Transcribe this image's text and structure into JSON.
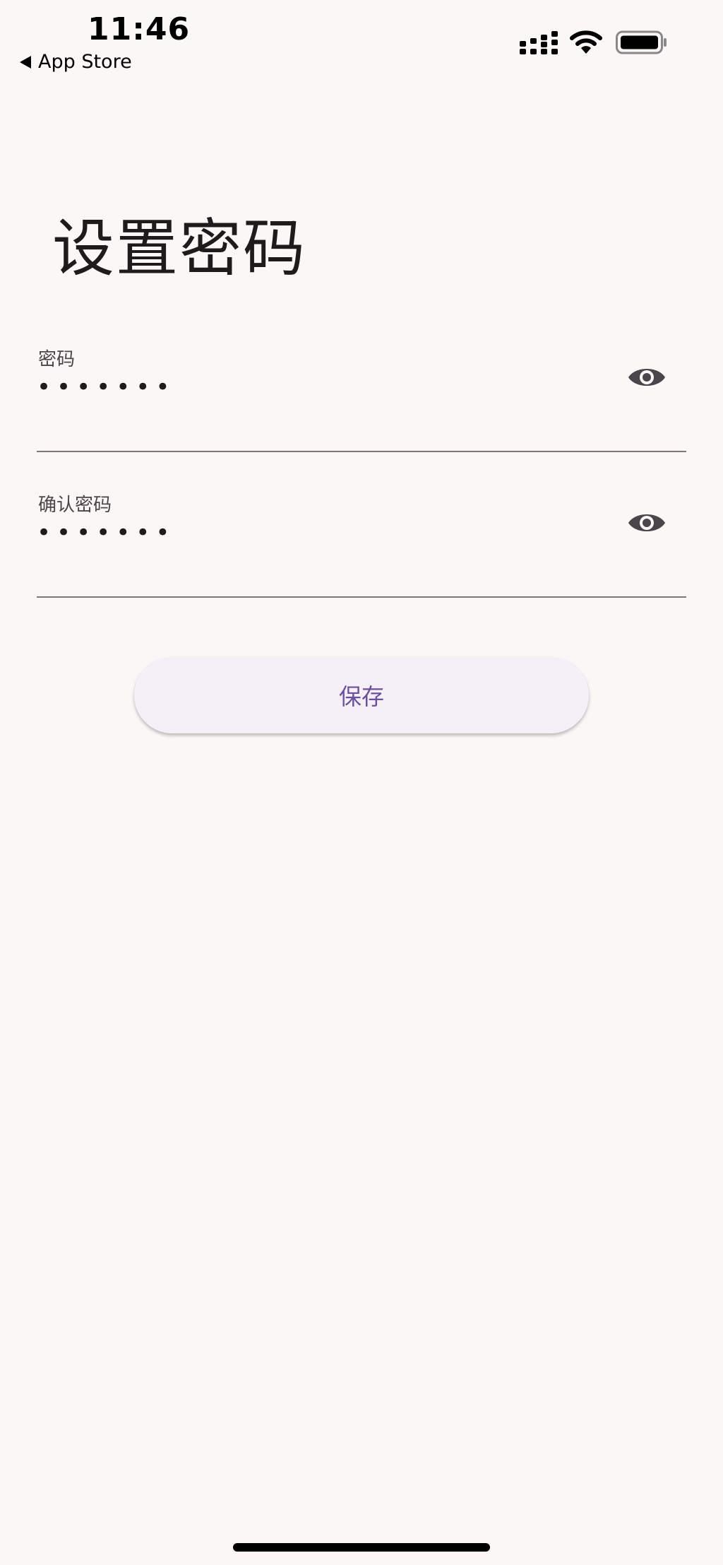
{
  "status_bar": {
    "time": "11:46",
    "back_label": "App Store",
    "icons": [
      "signal-icon",
      "wifi-icon",
      "battery-icon"
    ]
  },
  "page": {
    "title": "设置密码"
  },
  "form": {
    "password": {
      "label": "密码",
      "value": "•••••••",
      "toggle_icon": "eye-icon"
    },
    "confirm_password": {
      "label": "确认密码",
      "value": "•••••••",
      "toggle_icon": "eye-icon"
    },
    "save_label": "保存"
  },
  "colors": {
    "background": "#faf7f6",
    "button_background": "#f5f0f7",
    "button_text": "#6a4f9c",
    "divider": "#7d767a",
    "icon": "#49454b"
  }
}
